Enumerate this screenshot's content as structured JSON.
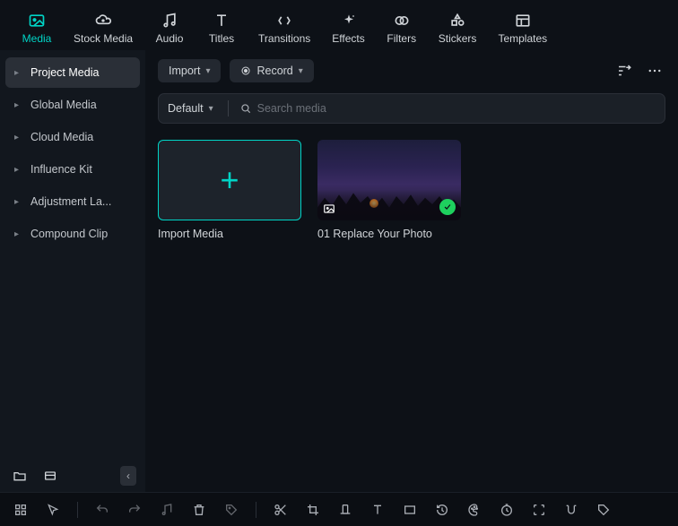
{
  "topnav": {
    "items": [
      {
        "label": "Media",
        "icon": "image"
      },
      {
        "label": "Stock Media",
        "icon": "cloud-image"
      },
      {
        "label": "Audio",
        "icon": "music"
      },
      {
        "label": "Titles",
        "icon": "text"
      },
      {
        "label": "Transitions",
        "icon": "transition"
      },
      {
        "label": "Effects",
        "icon": "sparkle"
      },
      {
        "label": "Filters",
        "icon": "venn"
      },
      {
        "label": "Stickers",
        "icon": "shapes"
      },
      {
        "label": "Templates",
        "icon": "template"
      }
    ],
    "active_index": 0
  },
  "sidebar": {
    "items": [
      {
        "label": "Project Media"
      },
      {
        "label": "Global Media"
      },
      {
        "label": "Cloud Media"
      },
      {
        "label": "Influence Kit"
      },
      {
        "label": "Adjustment La..."
      },
      {
        "label": "Compound Clip"
      }
    ],
    "active_index": 0
  },
  "toolbar": {
    "import_label": "Import",
    "record_label": "Record"
  },
  "search": {
    "sort_label": "Default",
    "placeholder": "Search media"
  },
  "grid": {
    "tiles": [
      {
        "kind": "import",
        "label": "Import Media"
      },
      {
        "kind": "photo",
        "label": "01 Replace Your Photo"
      }
    ]
  },
  "bottombar": {
    "tools": [
      "grid",
      "cursor",
      "|",
      "undo",
      "redo",
      "audio-sync",
      "trash",
      "tag",
      "|",
      "scissors",
      "crop",
      "orient",
      "text-tool",
      "square",
      "clock",
      "palette",
      "timer",
      "edge-detect",
      "snap",
      "tag2"
    ]
  }
}
